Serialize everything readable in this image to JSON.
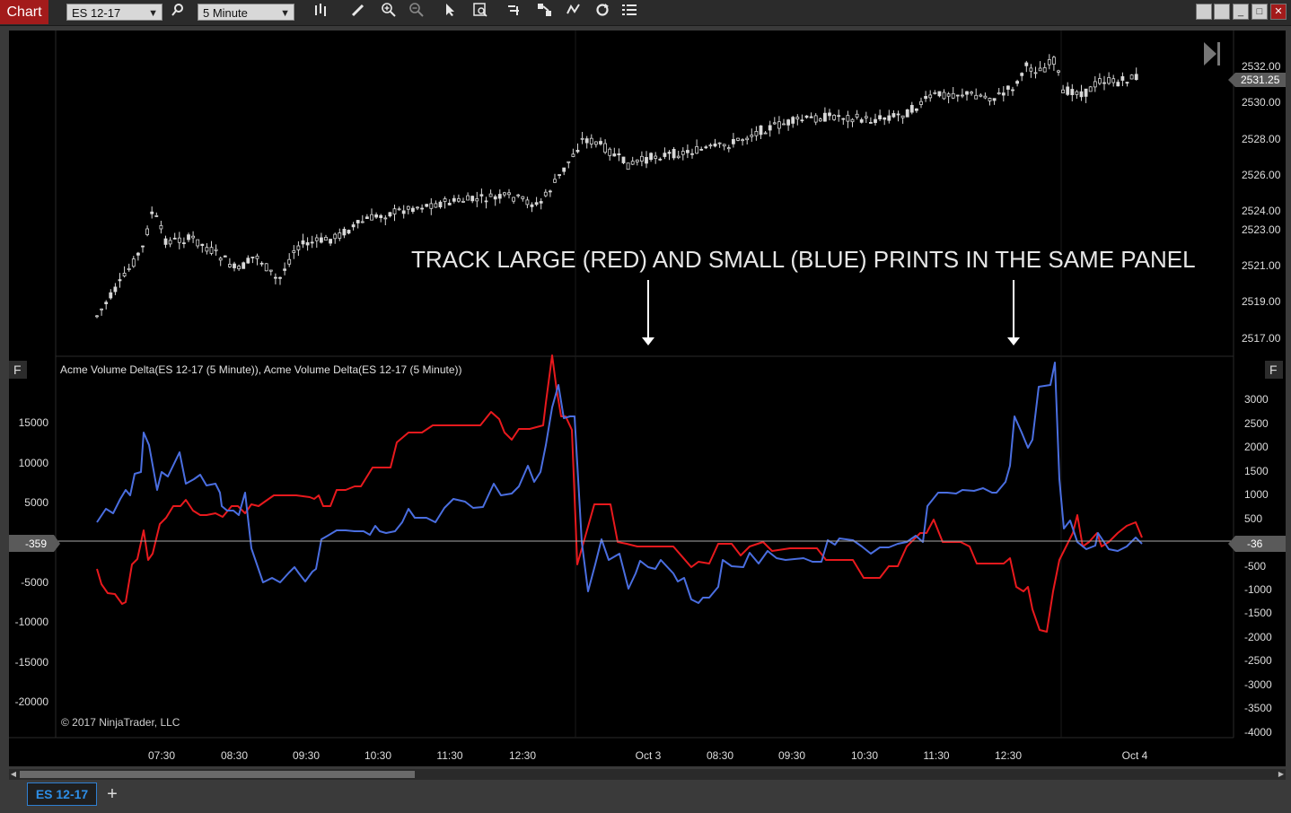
{
  "toolbar": {
    "chart_tab": "Chart",
    "instrument": "ES 12-17",
    "interval": "5 Minute",
    "icons": [
      "search-icon",
      "bar-type-icon",
      "pencil-icon",
      "zoom-in-icon",
      "zoom-out-icon",
      "pointer-icon",
      "data-box-icon",
      "indicators-icon",
      "strategies-icon",
      "properties-icon",
      "reload-icon",
      "menu-icon"
    ],
    "window_buttons": [
      "tile-icon",
      "tile-icon",
      "minimize-icon",
      "maximize-icon",
      "close-icon"
    ]
  },
  "chart": {
    "annotation": "TRACK LARGE (RED) AND SMALL (BLUE) PRINTS IN THE SAME PANEL",
    "panel_label": "Acme Volume Delta(ES 12-17 (5 Minute)), Acme Volume Delta(ES 12-17 (5 Minute))",
    "panel_button": "F",
    "copyright": "© 2017 NinjaTrader, LLC",
    "price_axis": [
      "2532.00",
      "2530.00",
      "2528.00",
      "2526.00",
      "2524.00",
      "2523.00",
      "2521.00",
      "2519.00",
      "2517.00"
    ],
    "last_price": "2531.25",
    "left_axis": [
      "15000",
      "10000",
      "5000",
      "-5000",
      "-10000",
      "-15000",
      "-20000"
    ],
    "left_marker": "-359",
    "right_axis": [
      "3000",
      "2500",
      "2000",
      "1500",
      "1000",
      "500",
      "-500",
      "-1000",
      "-1500",
      "-2000",
      "-2500",
      "-3000",
      "-3500",
      "-4000"
    ],
    "right_marker": "-36",
    "time_axis": [
      "07:30",
      "08:30",
      "09:30",
      "10:30",
      "11:30",
      "12:30",
      "Oct 3",
      "08:30",
      "09:30",
      "10:30",
      "11:30",
      "12:30",
      "Oct 4"
    ],
    "colors": {
      "large_prints": "#e8191d",
      "small_prints": "#4a6ee0",
      "candles": "#d8d8d8",
      "background": "#000000"
    }
  },
  "tabs": {
    "instrument_tab": "ES 12-17",
    "add_tab": "+"
  }
}
